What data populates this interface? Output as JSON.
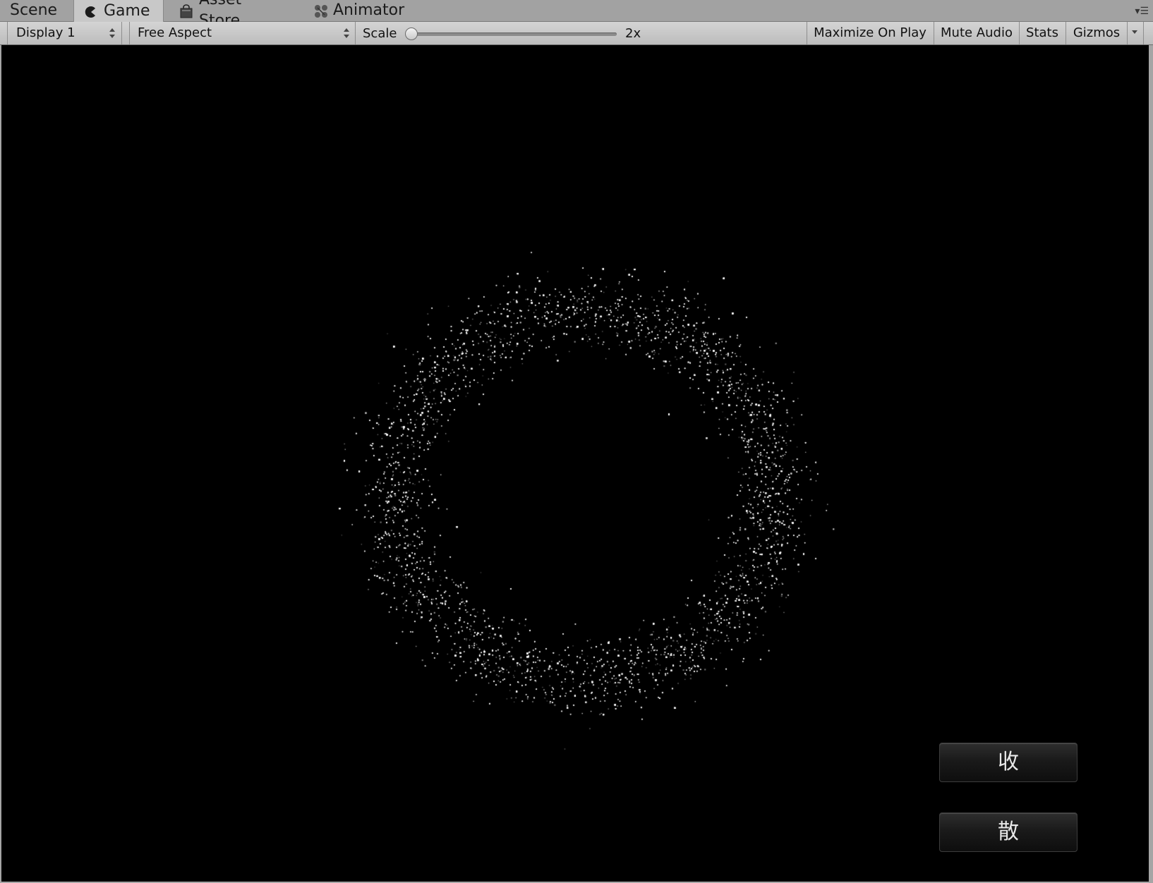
{
  "tabs": [
    {
      "label": "Scene",
      "icon": "none",
      "active": false
    },
    {
      "label": "Game",
      "icon": "pacman-icon",
      "active": true
    },
    {
      "label": "Asset Store",
      "icon": "shopping-bag-icon",
      "active": false
    },
    {
      "label": "Animator",
      "icon": "animator-nodes-icon",
      "active": false
    }
  ],
  "toolbar": {
    "display_select": "Display 1",
    "aspect_select": "Free Aspect",
    "scale_label": "Scale",
    "scale_value": "2x",
    "scale_slider_fraction": 0.0,
    "maximize_label": "Maximize On Play",
    "mute_label": "Mute Audio",
    "stats_label": "Stats",
    "gizmos_label": "Gizmos"
  },
  "game": {
    "background_color": "#000000",
    "particle_color": "#ffffff",
    "buttons": {
      "gather_label": "收",
      "scatter_label": "散"
    }
  }
}
